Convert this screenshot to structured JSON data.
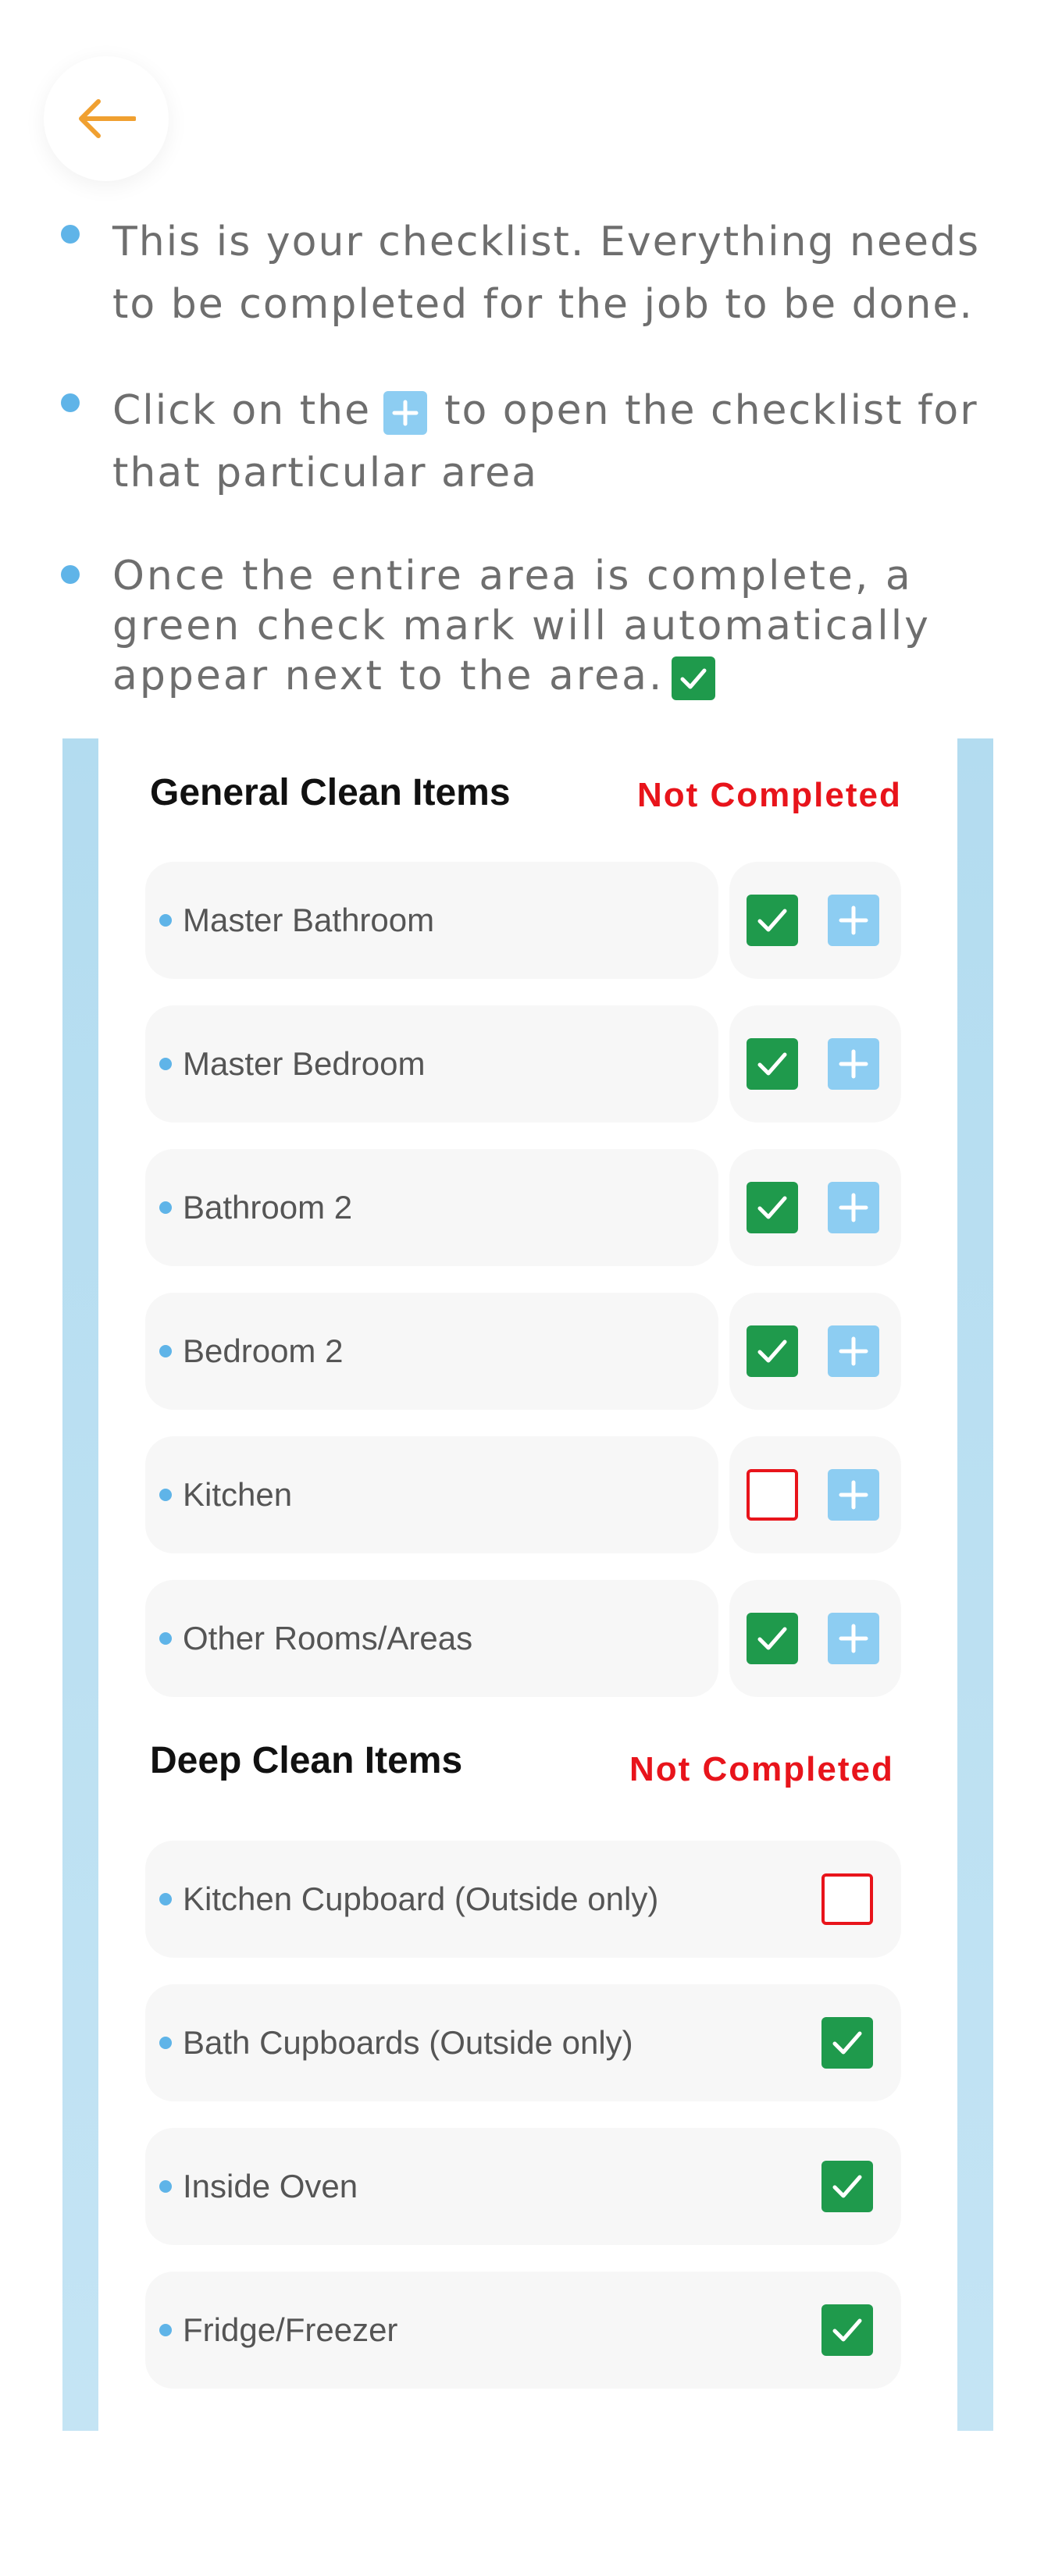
{
  "header": {
    "back_icon": "arrow-left-icon",
    "accent": "#f0a030"
  },
  "instructions": [
    {
      "text": "This is your checklist. Everything needs to be completed for the job to be done."
    },
    {
      "before": "Click on the",
      "icon": "plus-icon",
      "after": "to open the checklist for that particular area"
    },
    {
      "text": "Once the entire area is complete, a green check mark will automatically appear next to the area.",
      "icon": "check-icon"
    }
  ],
  "general": {
    "title": "General Clean Items",
    "status": "Not Completed",
    "items": [
      {
        "label": "Master Bathroom",
        "checked": true
      },
      {
        "label": "Master Bedroom",
        "checked": true
      },
      {
        "label": "Bathroom 2",
        "checked": true
      },
      {
        "label": "Bedroom 2",
        "checked": true
      },
      {
        "label": "Kitchen",
        "checked": false
      },
      {
        "label": "Other Rooms/Areas",
        "checked": true
      }
    ]
  },
  "deep": {
    "title": "Deep Clean Items",
    "status": "Not Completed",
    "items": [
      {
        "label": "Kitchen Cupboard (Outside only)",
        "checked": false
      },
      {
        "label": "Bath Cupboards (Outside only)",
        "checked": true
      },
      {
        "label": "Inside Oven",
        "checked": true
      },
      {
        "label": "Fridge/Freezer",
        "checked": true
      }
    ]
  },
  "colors": {
    "check_green": "#1f9a4c",
    "plus_blue": "#8dcdf2",
    "status_red": "#e8141b",
    "bullet_blue": "#5fb4e8"
  }
}
